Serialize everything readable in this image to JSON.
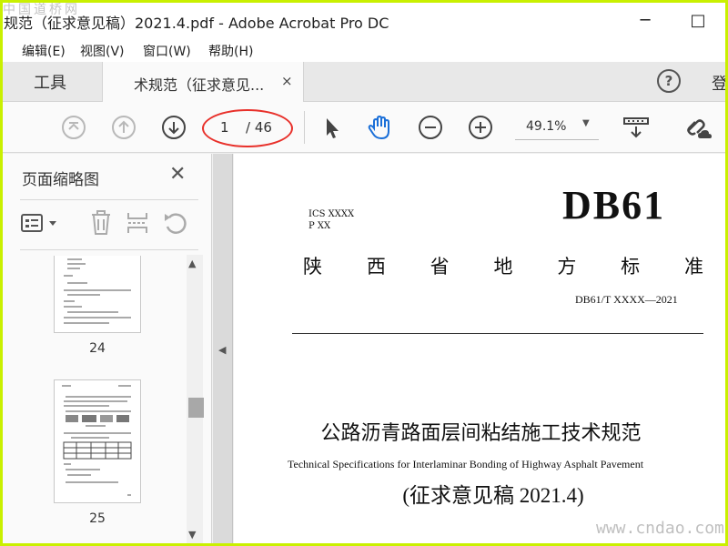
{
  "window": {
    "title": "规范（征求意见稿）2021.4.pdf - Adobe Acrobat Pro DC",
    "minimize": "─",
    "maximize": "□",
    "watermark_logo": "中国道桥网"
  },
  "menu": [
    "编辑(E)",
    "视图(V)",
    "窗口(W)",
    "帮助(H)"
  ],
  "tabs": {
    "tools_label": "工具",
    "doc_label": "术规范（征求意见...",
    "close": "×",
    "help": "?",
    "login": "登"
  },
  "toolbar": {
    "page_current": "1",
    "page_total": "/ 46",
    "zoom": "49.1%",
    "zoom_caret": "▼",
    "icons": [
      "first-page-icon",
      "previous-page-icon",
      "next-page-icon",
      "select-cursor-icon",
      "hand-tool-icon",
      "zoom-out-icon",
      "zoom-in-icon",
      "scroll-mode-icon",
      "share-link-icon"
    ]
  },
  "panel": {
    "title": "页面缩略图",
    "close": "✕",
    "tools": [
      "thumbnail-options-icon",
      "delete-page-icon",
      "insert-page-icon",
      "rotate-page-icon"
    ],
    "thumbnails": [
      {
        "page": "24"
      },
      {
        "page": "25"
      }
    ],
    "scroll_up": "▲",
    "scroll_down": "▼",
    "collapse": "◀"
  },
  "document": {
    "ics_line1": "ICS  XXXX",
    "ics_line2": "P XX",
    "standard_prefix": "DB61",
    "province_chars": [
      "陕",
      "西",
      "省",
      "地",
      "方",
      "标",
      "准"
    ],
    "standard_code": "DB61/T XXXX—2021",
    "title_cn": "公路沥青路面层间粘结施工技术规范",
    "title_en": "Technical Specifications for Interlaminar Bonding of Highway Asphalt Pavement",
    "draft": "(征求意见稿 2021.4)"
  },
  "watermark_url": "www.cndao.com",
  "colors": {
    "frame": "#c9f000",
    "highlight_ellipse": "#e8302a",
    "hand_tool": "#1a6fd8"
  }
}
